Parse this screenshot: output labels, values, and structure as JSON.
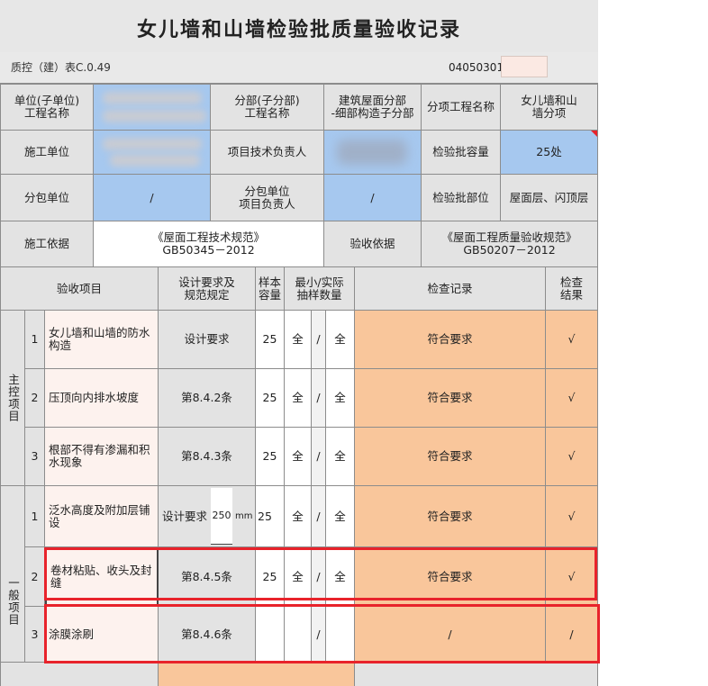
{
  "title": "女儿墙和山墙检验批质量验收记录",
  "form_code": "质控（建）表C.0.49",
  "serial_no": "04050301",
  "header": {
    "unit_label": "单位(子单位)\n工程名称",
    "division_label": "分部(子分部)\n工程名称",
    "division_value": "建筑屋面分部\n-细部构造子分部",
    "item_label": "分项工程名称",
    "item_value": "女儿墙和山\n墙分项",
    "contractor_label": "施工单位",
    "tech_lead_label": "项目技术负责人",
    "capacity_label": "检验批容量",
    "capacity_value": "25处",
    "sub_unit_label": "分包单位",
    "sub_unit_value": "/",
    "sub_lead_label": "分包单位\n项目负责人",
    "sub_lead_value": "/",
    "batch_part_label": "检验批部位",
    "batch_part_value": "屋面层、闪顶层",
    "basis_label": "施工依据",
    "basis_value": "《屋面工程技术规范》\nGB50345－2012",
    "accept_basis_label": "验收依据",
    "accept_basis_value": "《屋面工程质量验收规范》\nGB50207－2012"
  },
  "columns": {
    "item": "验收项目",
    "design": "设计要求及\n规范规定",
    "sample": "样本\n容量",
    "minreal": "最小/实际\n抽样数量",
    "record": "检查记录",
    "result": "检查\n结果"
  },
  "groups": {
    "main": "主控项目",
    "general": "一般项目"
  },
  "rows": [
    {
      "no": "1",
      "name": "女儿墙和山墙的防水构造",
      "design": "设计要求",
      "sample": "25",
      "min": "全",
      "slash": "/",
      "real": "全",
      "record": "符合要求",
      "result": "√"
    },
    {
      "no": "2",
      "name": "压顶向内排水坡度",
      "design": "第8.4.2条",
      "sample": "25",
      "min": "全",
      "slash": "/",
      "real": "全",
      "record": "符合要求",
      "result": "√"
    },
    {
      "no": "3",
      "name": "根部不得有渗漏和积水现象",
      "design": "第8.4.3条",
      "sample": "25",
      "min": "全",
      "slash": "/",
      "real": "全",
      "record": "符合要求",
      "result": "√"
    },
    {
      "no": "1",
      "name": "泛水高度及附加层铺设",
      "design": "设计要求",
      "design_value": "250",
      "design_unit": "mm",
      "sample": "25",
      "min": "全",
      "slash": "/",
      "real": "全",
      "record": "符合要求",
      "result": "√"
    },
    {
      "no": "2",
      "name": "卷材粘贴、收头及封缝",
      "design": "第8.4.5条",
      "sample": "25",
      "min": "全",
      "slash": "/",
      "real": "全",
      "record": "符合要求",
      "result": "√"
    },
    {
      "no": "3",
      "name": "涂膜涂刷",
      "design": "第8.4.6条",
      "sample": "",
      "min": "",
      "slash": "/",
      "real": "",
      "record": "/",
      "result": "/"
    }
  ],
  "colors": {
    "blue_cell": "#a6c8ef",
    "orange_cell": "#f9c69b",
    "highlight": "#e8232b"
  }
}
